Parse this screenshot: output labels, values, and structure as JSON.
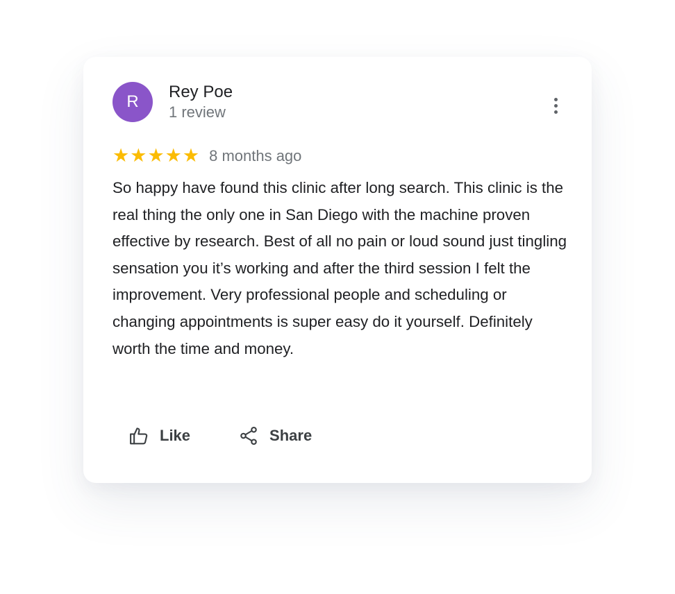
{
  "reviewer": {
    "initial": "R",
    "name": "Rey Poe",
    "review_count": "1 review",
    "avatar_color": "#8a55c9"
  },
  "rating": {
    "stars": 5,
    "max": 5,
    "star_glyph": "★",
    "star_color": "#fbbc04",
    "time_ago": "8 months ago"
  },
  "review_text": "So happy have found this clinic after long search. This clinic is the real thing the only one in San Diego with the machine proven effective by research. Best of all no pain or loud sound just tingling sensation you it’s working and after the third session I felt the improvement. Very professional people and scheduling or changing appointments is super easy do it yourself. Definitely worth the time and money.",
  "actions": {
    "like_label": "Like",
    "like_icon": "thumbs-up-icon",
    "share_label": "Share",
    "share_icon": "share-icon"
  },
  "menu_icon": "more-vert-icon"
}
